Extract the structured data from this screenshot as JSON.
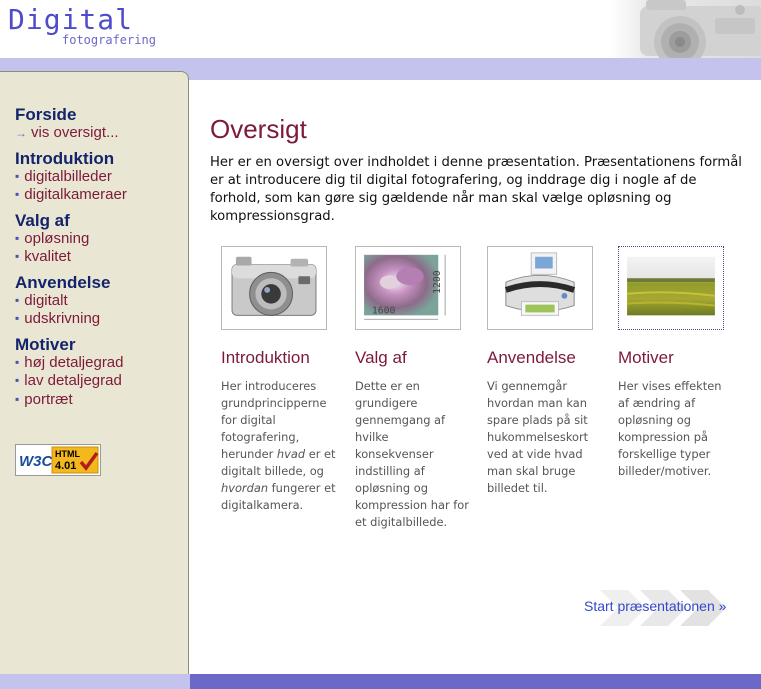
{
  "header": {
    "logo_title": "Digital",
    "logo_subtitle": "fotografering"
  },
  "sidebar": {
    "groups": [
      {
        "heading": "Forside",
        "items": [
          {
            "label": "vis oversigt...",
            "marker": "arrow"
          }
        ]
      },
      {
        "heading": "Introduktion",
        "items": [
          {
            "label": "digitalbilleder"
          },
          {
            "label": "digitalkameraer"
          }
        ]
      },
      {
        "heading": "Valg af",
        "items": [
          {
            "label": "opløsning"
          },
          {
            "label": "kvalitet"
          }
        ]
      },
      {
        "heading": "Anvendelse",
        "items": [
          {
            "label": "digitalt"
          },
          {
            "label": "udskrivning"
          }
        ]
      },
      {
        "heading": "Motiver",
        "items": [
          {
            "label": "høj detaljegrad"
          },
          {
            "label": "lav detaljegrad"
          },
          {
            "label": "portræt"
          }
        ]
      }
    ],
    "badge": {
      "left": "W3C",
      "html": "HTML",
      "version": "4.01"
    }
  },
  "main": {
    "title": "Oversigt",
    "intro": "Her er en oversigt over indholdet i denne præsentation. Præsentationens formål er at introducere dig til digital fotografering, og inddrage dig i nogle af de forhold, som kan gøre sig gældende når man skal vælge opløsning og kompressionsgrad.",
    "cards": [
      {
        "title": "Introduktion",
        "desc_1": "Her introduceres grundprincipperne for digital fotografering, herunder ",
        "em_1": "hvad",
        "desc_2": " er et digitalt billede, og ",
        "em_2": "hvordan",
        "desc_3": " fungerer et digitalkamera."
      },
      {
        "title": "Valg af",
        "desc": "Dette er en grundigere gennemgang af hvilke konsekvenser indstilling af opløsning og kompression har for et digitalbillede.",
        "thumb_labels": {
          "width": "1600",
          "height": "1200"
        }
      },
      {
        "title": "Anvendelse",
        "desc": "Vi gennemgår hvordan man kan spare plads på sit hukommelseskort ved at vide hvad man skal bruge billedet til."
      },
      {
        "title": "Motiver",
        "desc": "Her vises effekten af ændring af opløsning og kompression på forskellige typer billeder/motiver."
      }
    ],
    "start_link": "Start præsentationen »"
  },
  "colors": {
    "accent_maroon": "#7d1a3a",
    "nav_heading_navy": "#14246b",
    "logo_purple": "#4f4ccc",
    "band_lavender": "#c4c3ee",
    "band_dark": "#6c68c8",
    "sidebar_beige": "#e9e7d3",
    "link_blue": "#3548c9"
  }
}
